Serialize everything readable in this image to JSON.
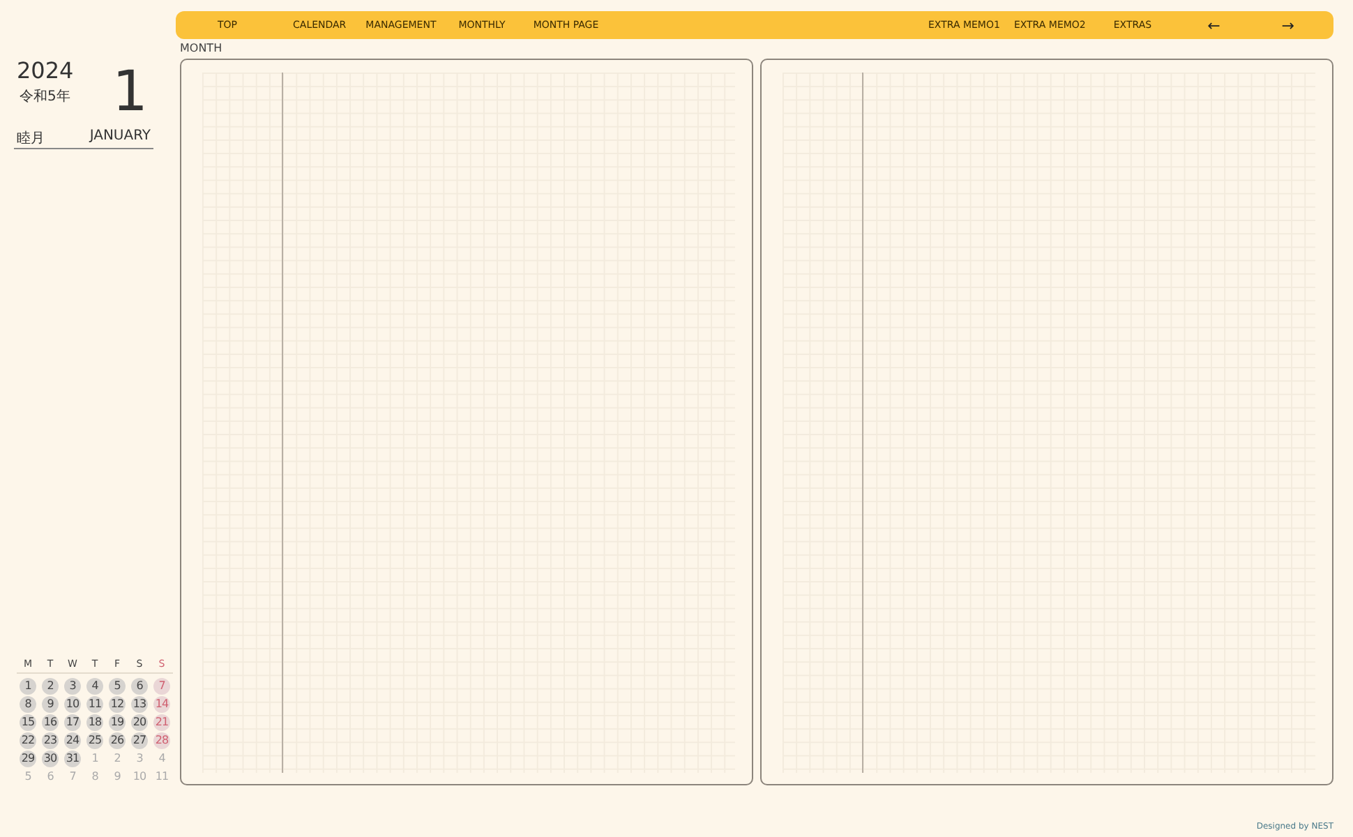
{
  "nav": {
    "items": [
      {
        "label": "TOP",
        "selected": false
      },
      {
        "label": "CALENDAR",
        "selected": false
      },
      {
        "label": "MANAGEMENT",
        "selected": false
      },
      {
        "label": "MONTHLY",
        "selected": false
      },
      {
        "label": "MONTH PAGE",
        "selected": false
      }
    ],
    "right_items": [
      {
        "label": "EXTRA MEMO1"
      },
      {
        "label": "EXTRA MEMO2"
      },
      {
        "label": "EXTRAS"
      }
    ],
    "prev": "←",
    "next": "→"
  },
  "section_label": "MONTH",
  "date": {
    "year": "2024",
    "era": "令和5年",
    "month_number": "1",
    "month_jp": "睦月",
    "month_en": "JANUARY"
  },
  "mini_calendar": {
    "weekdays": [
      {
        "label": "M",
        "sunday": false
      },
      {
        "label": "T",
        "sunday": false
      },
      {
        "label": "W",
        "sunday": false
      },
      {
        "label": "T",
        "sunday": false
      },
      {
        "label": "F",
        "sunday": false
      },
      {
        "label": "S",
        "sunday": false
      },
      {
        "label": "S",
        "sunday": true
      }
    ],
    "days": [
      {
        "day": "1",
        "in_month": true
      },
      {
        "day": "2",
        "in_month": true
      },
      {
        "day": "3",
        "in_month": true
      },
      {
        "day": "4",
        "in_month": true
      },
      {
        "day": "5",
        "in_month": true
      },
      {
        "day": "6",
        "in_month": true
      },
      {
        "day": "7",
        "in_month": true
      },
      {
        "day": "8",
        "in_month": true
      },
      {
        "day": "9",
        "in_month": true
      },
      {
        "day": "10",
        "in_month": true
      },
      {
        "day": "11",
        "in_month": true
      },
      {
        "day": "12",
        "in_month": true
      },
      {
        "day": "13",
        "in_month": true
      },
      {
        "day": "14",
        "in_month": true
      },
      {
        "day": "15",
        "in_month": true
      },
      {
        "day": "16",
        "in_month": true
      },
      {
        "day": "17",
        "in_month": true
      },
      {
        "day": "18",
        "in_month": true
      },
      {
        "day": "19",
        "in_month": true
      },
      {
        "day": "20",
        "in_month": true
      },
      {
        "day": "21",
        "in_month": true
      },
      {
        "day": "22",
        "in_month": true
      },
      {
        "day": "23",
        "in_month": true
      },
      {
        "day": "24",
        "in_month": true
      },
      {
        "day": "25",
        "in_month": true
      },
      {
        "day": "26",
        "in_month": true
      },
      {
        "day": "27",
        "in_month": true
      },
      {
        "day": "28",
        "in_month": true
      },
      {
        "day": "29",
        "in_month": true
      },
      {
        "day": "30",
        "in_month": true
      },
      {
        "day": "31",
        "in_month": true
      },
      {
        "day": "1",
        "in_month": false
      },
      {
        "day": "2",
        "in_month": false
      },
      {
        "day": "3",
        "in_month": false
      },
      {
        "day": "4",
        "in_month": false
      },
      {
        "day": "5",
        "in_month": false
      },
      {
        "day": "6",
        "in_month": false
      },
      {
        "day": "7",
        "in_month": false
      },
      {
        "day": "8",
        "in_month": false
      },
      {
        "day": "9",
        "in_month": false
      },
      {
        "day": "10",
        "in_month": false
      },
      {
        "day": "11",
        "in_month": false
      }
    ]
  },
  "pages": [
    {
      "kind": "grid"
    },
    {
      "kind": "grid"
    }
  ],
  "footer": "Designed by NEST"
}
